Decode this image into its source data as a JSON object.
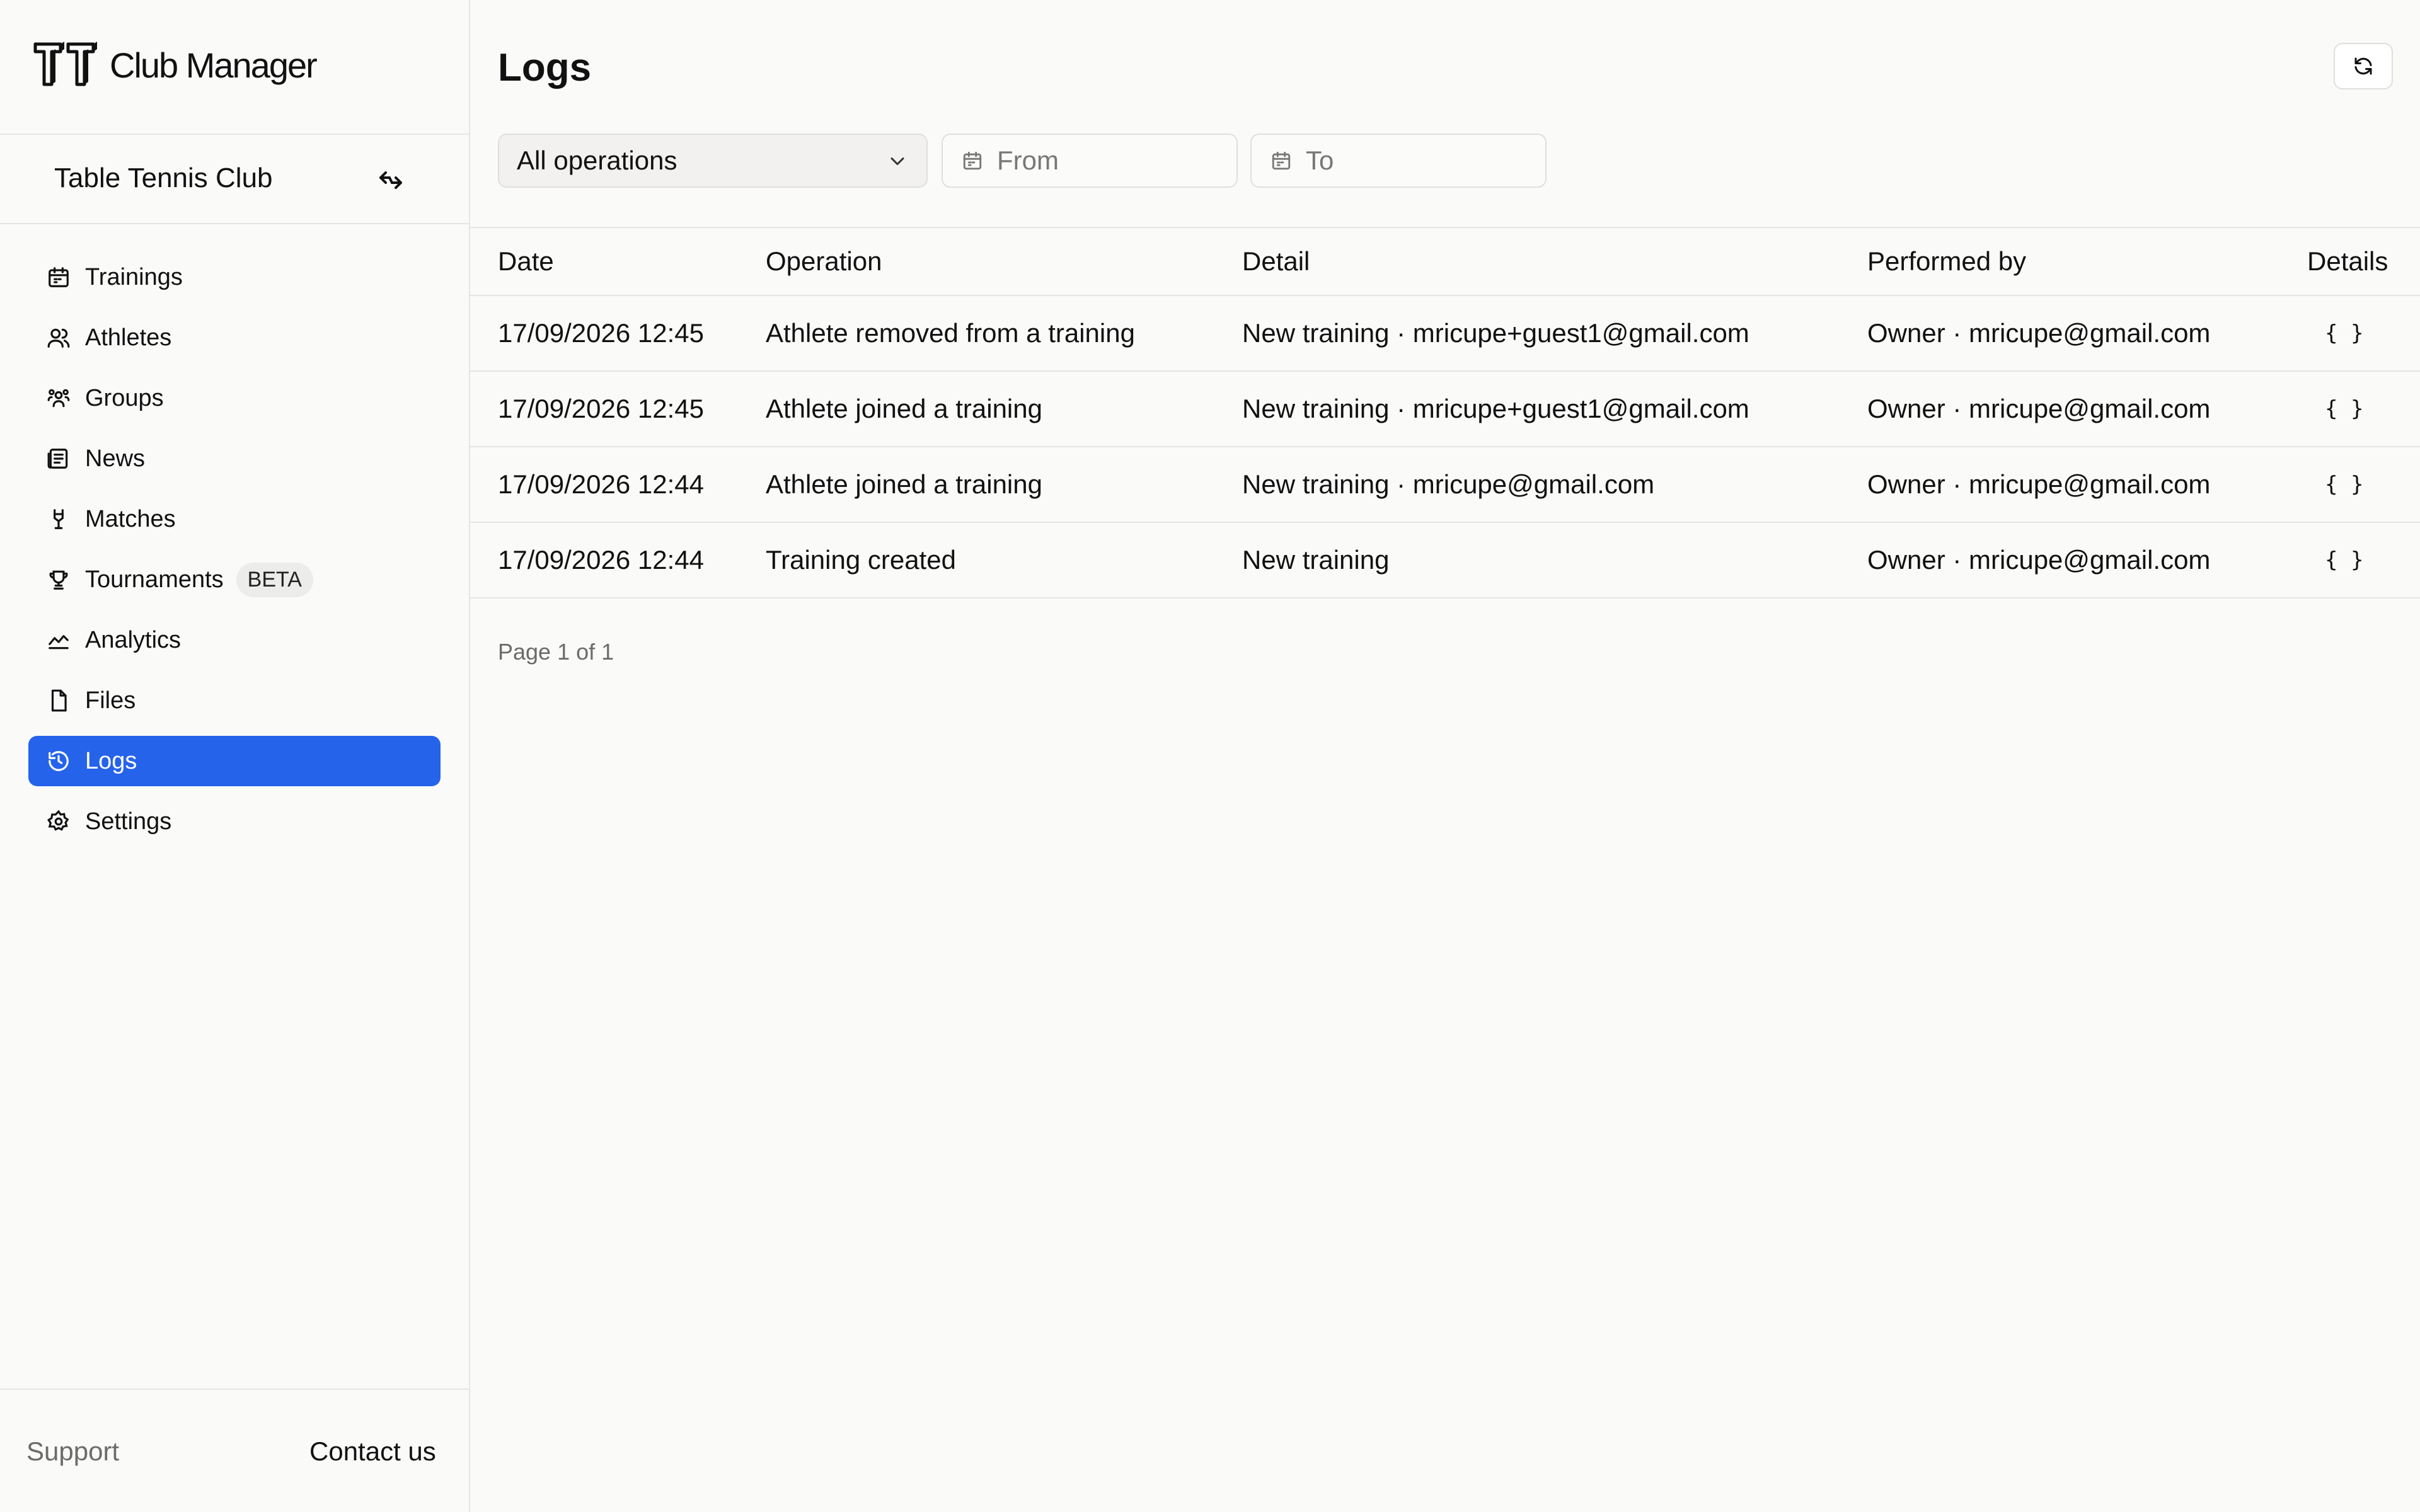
{
  "app": {
    "name": "Club Manager"
  },
  "club": {
    "name": "Table Tennis Club"
  },
  "nav": [
    {
      "label": "Trainings",
      "icon": "calendar-icon"
    },
    {
      "label": "Athletes",
      "icon": "users-icon"
    },
    {
      "label": "Groups",
      "icon": "group-icon"
    },
    {
      "label": "News",
      "icon": "newspaper-icon"
    },
    {
      "label": "Matches",
      "icon": "swords-icon"
    },
    {
      "label": "Tournaments",
      "icon": "trophy-icon",
      "badge": "BETA"
    },
    {
      "label": "Analytics",
      "icon": "chart-line-icon"
    },
    {
      "label": "Files",
      "icon": "file-icon"
    },
    {
      "label": "Logs",
      "icon": "history-icon",
      "active": true
    },
    {
      "label": "Settings",
      "icon": "gear-icon"
    }
  ],
  "footer": {
    "support": "Support",
    "contact": "Contact us"
  },
  "page": {
    "title": "Logs"
  },
  "filters": {
    "operation": "All operations",
    "from_placeholder": "From",
    "to_placeholder": "To"
  },
  "table": {
    "headers": [
      "Date",
      "Operation",
      "Detail",
      "Performed by",
      "Details"
    ],
    "rows": [
      {
        "date": "17/09/2026 12:45",
        "operation": "Athlete removed from a training",
        "detail": "New training · mricupe+guest1@gmail.com",
        "performed_by": "Owner · mricupe@gmail.com",
        "details": "{ }"
      },
      {
        "date": "17/09/2026 12:45",
        "operation": "Athlete joined a training",
        "detail": "New training · mricupe+guest1@gmail.com",
        "performed_by": "Owner · mricupe@gmail.com",
        "details": "{ }"
      },
      {
        "date": "17/09/2026 12:44",
        "operation": "Athlete joined a training",
        "detail": "New training · mricupe@gmail.com",
        "performed_by": "Owner · mricupe@gmail.com",
        "details": "{ }"
      },
      {
        "date": "17/09/2026 12:44",
        "operation": "Training created",
        "detail": "New training",
        "performed_by": "Owner · mricupe@gmail.com",
        "details": "{ }"
      }
    ]
  },
  "pagination": {
    "text": "Page 1 of 1"
  },
  "colors": {
    "accent": "#2563eb",
    "background": "#fafaf9",
    "border": "#e7e5e4"
  }
}
